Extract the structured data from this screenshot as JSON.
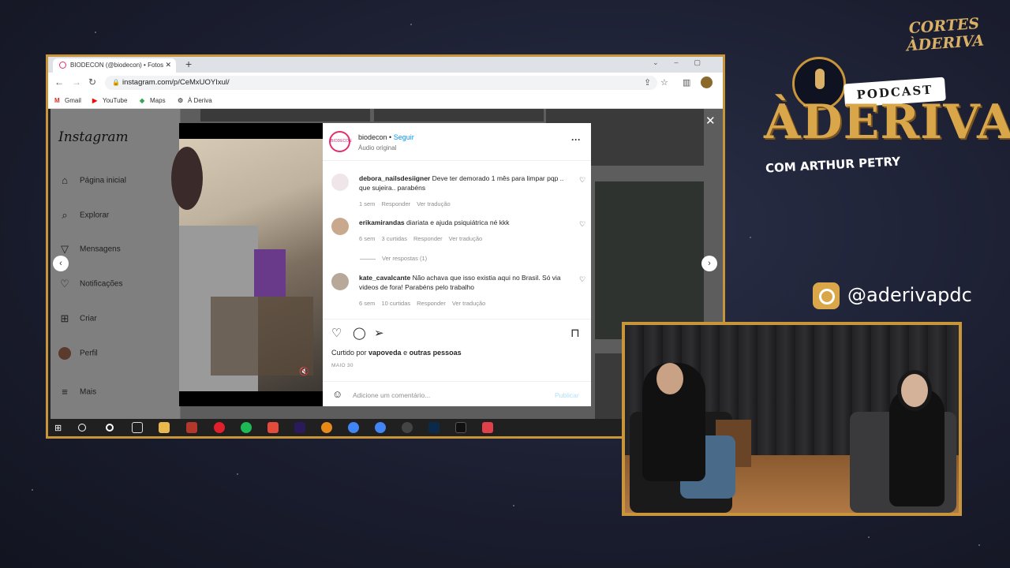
{
  "browser": {
    "tab_title": "BIODECON (@biodecon) • Fotos",
    "url": "instagram.com/p/CeMxUOYIxul/",
    "bookmarks": [
      "Gmail",
      "YouTube",
      "Maps",
      "À Deriva"
    ]
  },
  "instagram": {
    "logo": "Instagram",
    "sidebar": [
      "Página inicial",
      "Explorar",
      "Mensagens",
      "Notificações",
      "Criar",
      "Perfil",
      "Mais"
    ],
    "post": {
      "username": "biodecon",
      "follow": "Seguir",
      "audio": "Áudio original",
      "avatar_text": "BIODECON",
      "comments": [
        {
          "user": "debora_nailsdesiigner",
          "text": "Deve ter demorado 1 mês para limpar pqp .. que sujeira.. parabéns",
          "time": "1 sem",
          "likes": "",
          "reply": "Responder",
          "translate": "Ver tradução"
        },
        {
          "user": "erikamirandas",
          "text": "diariata e ajuda psiquiátrica né kkk",
          "time": "6 sem",
          "likes": "3 curtidas",
          "reply": "Responder",
          "translate": "Ver tradução"
        },
        {
          "user": "kate_cavalcante",
          "text": "Não achava que isso existia aqui no Brasil. Só via videos de fora! Parabéns pelo trabalho",
          "time": "6 sem",
          "likes": "10 curtidas",
          "reply": "Responder",
          "translate": "Ver tradução"
        }
      ],
      "view_replies": "Ver respostas (1)",
      "liked_prefix": "Curtido por",
      "liked_user": "vapoveda",
      "liked_mid": "e",
      "liked_others": "outras pessoas",
      "date": "MAIO 30",
      "add_comment": "Adicione um comentário...",
      "publish": "Publicar"
    }
  },
  "brand": {
    "cortes": "CORTES",
    "cortes2": "ÀDERIVA",
    "podcast": "PODCAST",
    "title": "ÀDERIVA",
    "subtitle": "COM ARTHUR PETRY",
    "handle": "@aderivapdc"
  },
  "colors": {
    "accent": "#c8953a",
    "gold": "#d9a64a",
    "ig_blue": "#0095f6"
  }
}
